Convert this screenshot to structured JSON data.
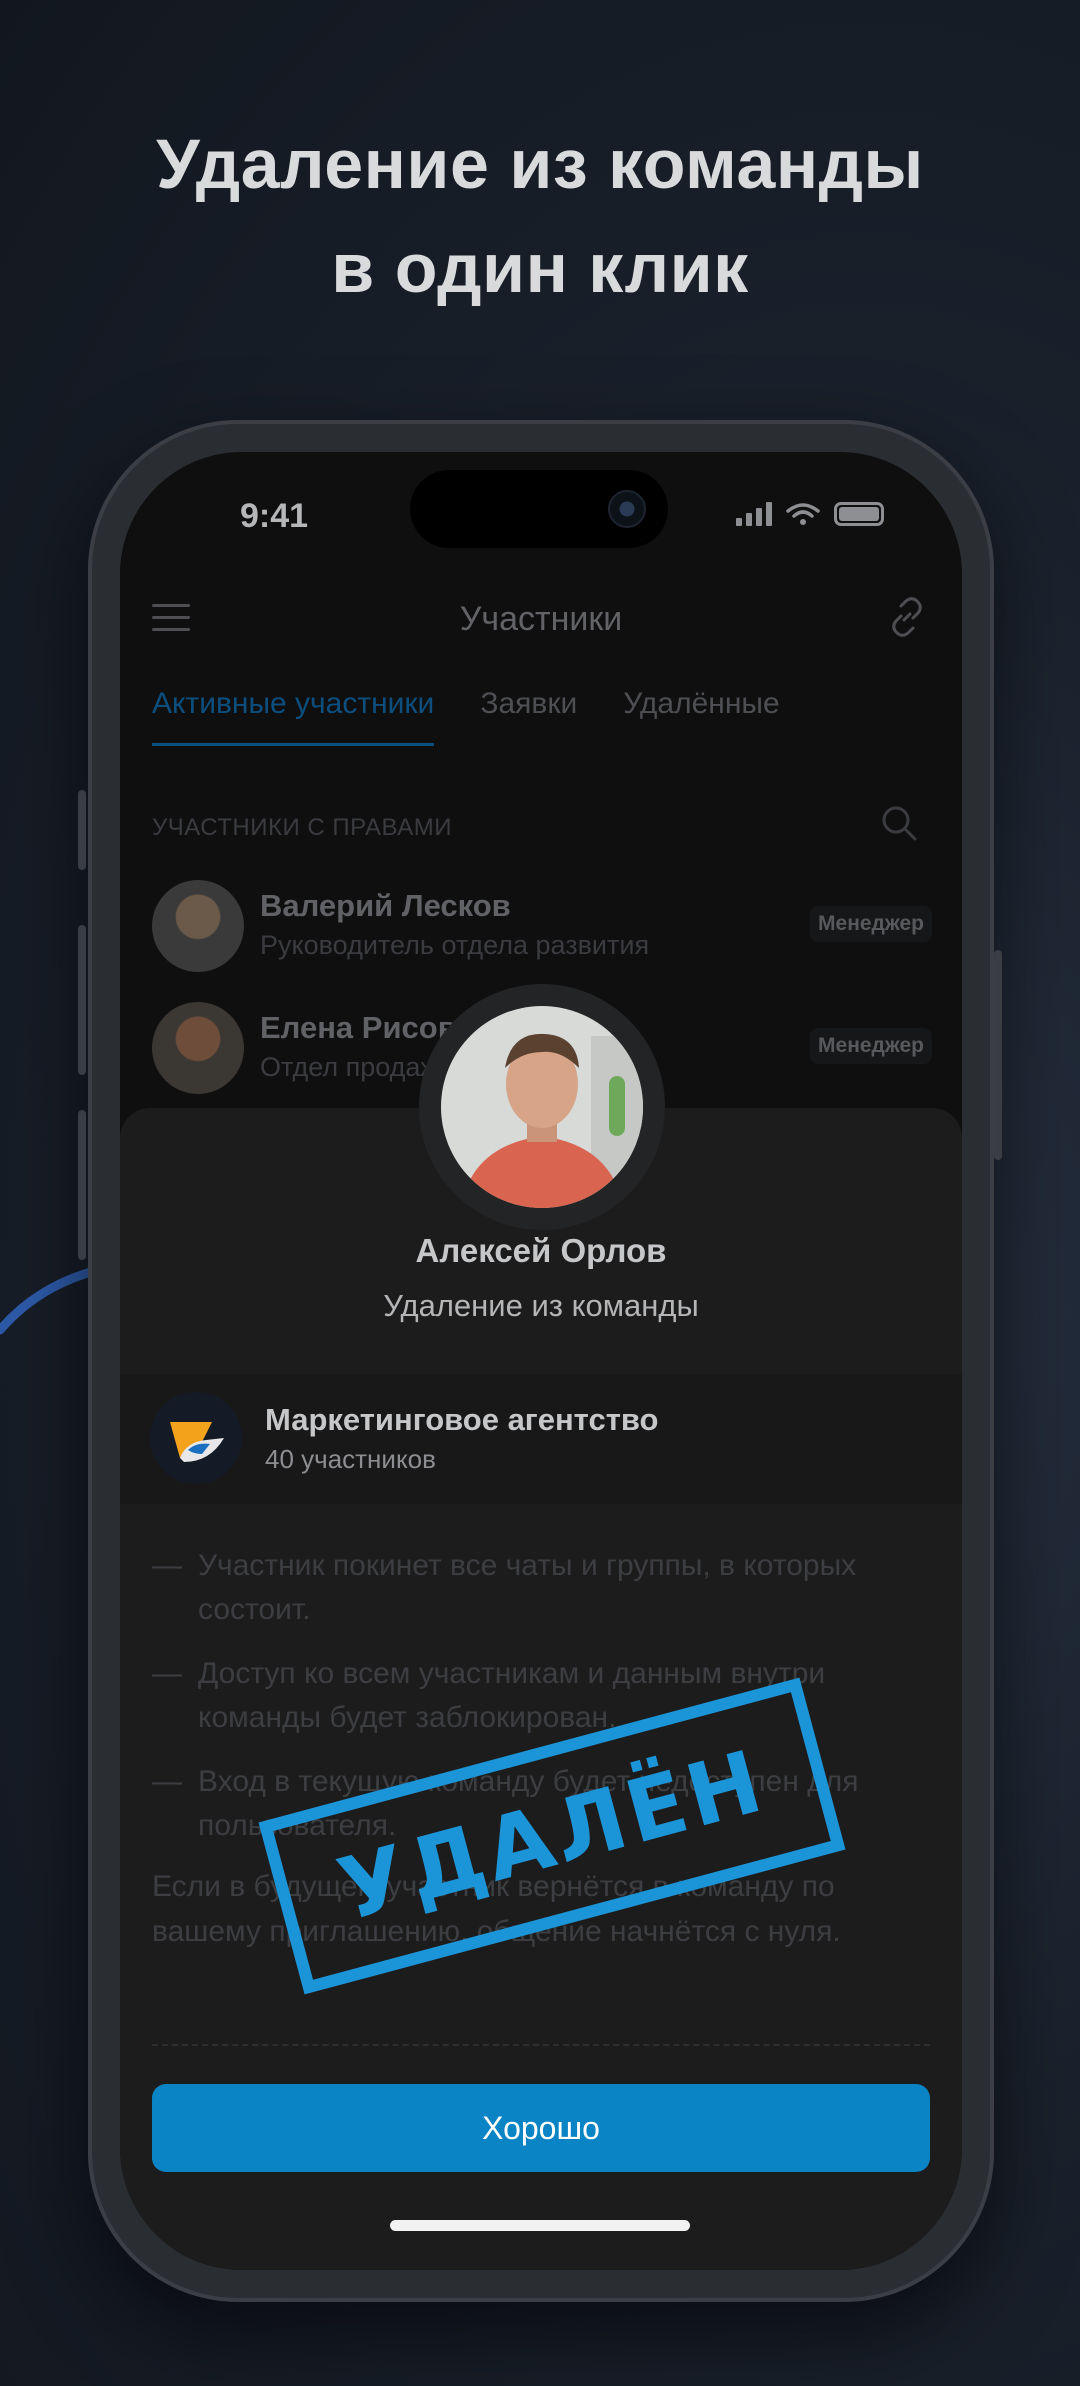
{
  "promo": {
    "headline_line1": "Удаление из команды",
    "headline_line2": "в один клик"
  },
  "status_bar": {
    "time": "9:41"
  },
  "header": {
    "title": "Участники"
  },
  "tabs": [
    {
      "label": "Активные участники",
      "active": true
    },
    {
      "label": "Заявки",
      "active": false
    },
    {
      "label": "Удалённые",
      "active": false
    }
  ],
  "section_label": "УЧАСТНИКИ С ПРАВАМИ",
  "members": [
    {
      "name": "Валерий Лесков",
      "role": "Руководитель отдела развития",
      "badge": "Менеджер"
    },
    {
      "name": "Елена Рисов",
      "role": "Отдел продаж",
      "badge": "Менеджер"
    }
  ],
  "sheet": {
    "name": "Алексей Орлов",
    "subtitle": "Удаление из команды",
    "team": {
      "name": "Маркетинговое агентство",
      "count": "40 участников"
    },
    "bullets": [
      "Участник покинет все чаты и группы, в которых состоит.",
      "Доступ ко всем участникам и данным внутри команды будет заблокирован.",
      "Вход в текущую команду будет недоступен для пользователя."
    ],
    "note": "Если в будущем участник вернётся в команду по вашему приглашению, общение начнётся с нуля.",
    "button_label": "Хорошо"
  },
  "stamp": {
    "text": "УДАЛЁН",
    "color": "#1c95d8"
  },
  "colors": {
    "accent": "#0a84c4",
    "background": "#161b23"
  },
  "icons": [
    "menu-icon",
    "link-icon",
    "search-icon",
    "camera-icon",
    "signal-icon",
    "wifi-icon",
    "battery-icon"
  ]
}
